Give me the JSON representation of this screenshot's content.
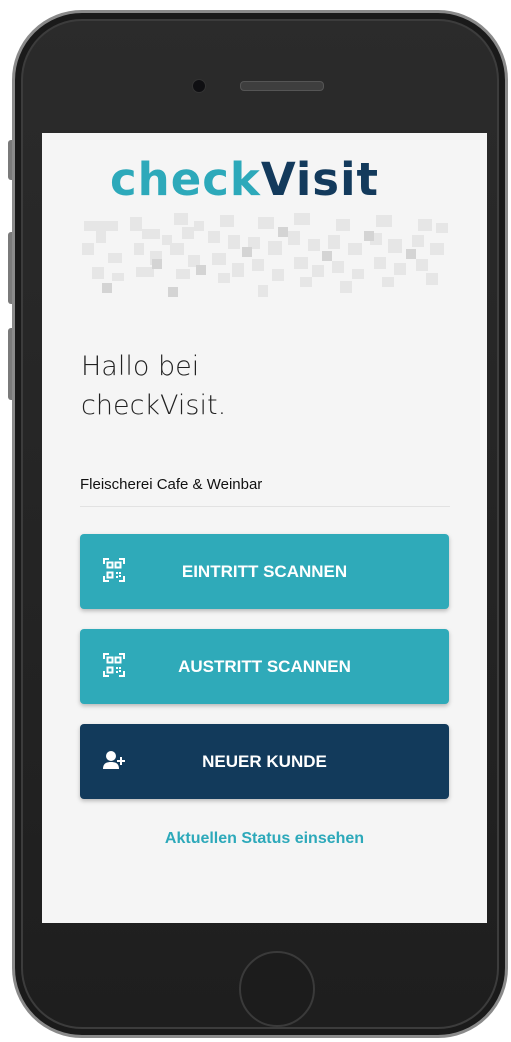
{
  "app": {
    "logo": {
      "part1": "check",
      "part2": "Visit"
    },
    "colors": {
      "teal": "#2faab9",
      "navy": "#123a5b",
      "screen_bg": "#f5f5f5"
    }
  },
  "greeting": {
    "line1": "Hallo bei",
    "line2": "checkVisit."
  },
  "business_name": "Fleischerei Cafe & Weinbar",
  "buttons": [
    {
      "label": "EINTRITT SCANNEN",
      "icon": "qr-scan-icon"
    },
    {
      "label": "AUSTRITT SCANNEN",
      "icon": "qr-scan-icon"
    },
    {
      "label": "NEUER KUNDE",
      "icon": "add-user-icon"
    }
  ],
  "status_link": "Aktuellen Status einsehen"
}
